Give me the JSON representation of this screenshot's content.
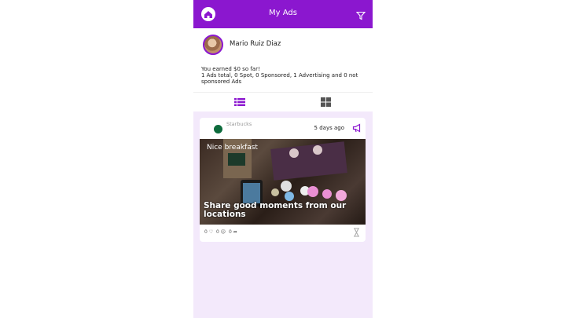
{
  "header": {
    "title": "My Ads",
    "home_icon": "home-icon",
    "filter_icon": "filter-icon",
    "accent": "#8b17cf"
  },
  "profile": {
    "name": "Mario Ruiz Diaz",
    "earned_line1": "You earned $0 so far!",
    "earned_line2": "1 Ads total, 0 Spot, 0 Sponsored, 1 Advertising and 0 not sponsored Ads"
  },
  "tabs": [
    {
      "icon": "list-icon",
      "active": true
    },
    {
      "icon": "grid-icon",
      "active": false
    }
  ],
  "card": {
    "brand": "Starbucks",
    "date": "5 days ago",
    "type_icon": "megaphone-icon",
    "caption": "Nice breakfast",
    "headline": "Share good moments from our locations",
    "stats": {
      "likes": "0",
      "dislikes": "0",
      "shares": "0"
    },
    "status_icon": "hourglass-icon"
  }
}
